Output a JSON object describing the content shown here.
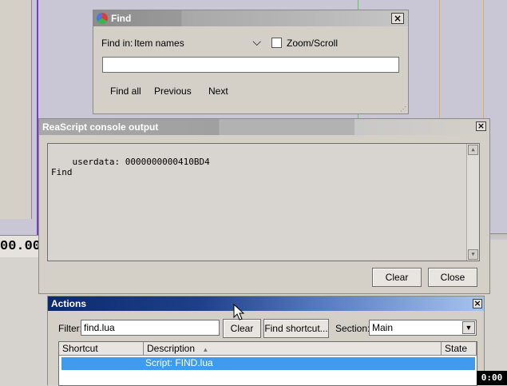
{
  "find_dialog": {
    "title": "Find",
    "find_in_label": "Find in:",
    "find_in_value": "Item names",
    "zoom_scroll_label": "Zoom/Scroll",
    "zoom_scroll_checked": false,
    "search_value": "",
    "find_all_label": "Find all",
    "previous_label": "Previous",
    "next_label": "Next",
    "close_glyph": "×"
  },
  "console": {
    "title": "ReaScript console output",
    "output_lines": "userdata: 0000000000410BD4\nFind",
    "clear_label": "Clear",
    "close_label": "Close",
    "close_glyph": "×"
  },
  "actions": {
    "title": "Actions",
    "filter_label": "Filter:",
    "filter_value": "find.lua",
    "clear_label": "Clear",
    "find_shortcut_label": "Find shortcut...",
    "section_label": "Section:",
    "section_value": "Main",
    "columns": [
      "Shortcut",
      "Description",
      "State"
    ],
    "rows": [
      {
        "shortcut": "",
        "description": "Script: FIND.lua",
        "state": ""
      }
    ],
    "close_glyph": "×"
  },
  "background": {
    "time_readout": "00.00"
  },
  "taskbar": {
    "clock": "0:00"
  },
  "icons": {
    "dropdown": "chevron-down-icon",
    "sort": "sort-up-icon",
    "app": "reaper-logo-icon"
  }
}
